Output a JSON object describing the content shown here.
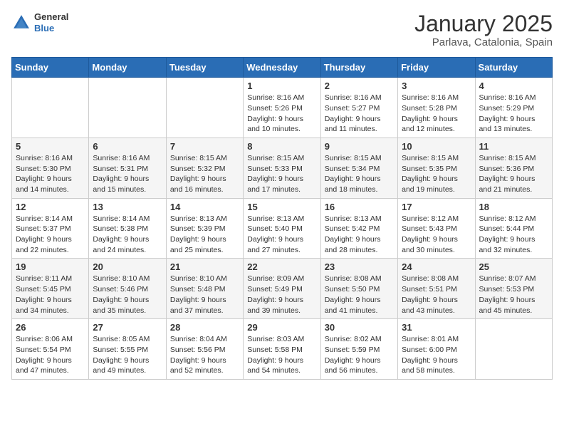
{
  "header": {
    "logo_general": "General",
    "logo_blue": "Blue",
    "title": "January 2025",
    "subtitle": "Parlava, Catalonia, Spain"
  },
  "days_of_week": [
    "Sunday",
    "Monday",
    "Tuesday",
    "Wednesday",
    "Thursday",
    "Friday",
    "Saturday"
  ],
  "weeks": [
    [
      {
        "day": "",
        "sunrise": "",
        "sunset": "",
        "daylight": ""
      },
      {
        "day": "",
        "sunrise": "",
        "sunset": "",
        "daylight": ""
      },
      {
        "day": "",
        "sunrise": "",
        "sunset": "",
        "daylight": ""
      },
      {
        "day": "1",
        "sunrise": "Sunrise: 8:16 AM",
        "sunset": "Sunset: 5:26 PM",
        "daylight": "Daylight: 9 hours and 10 minutes."
      },
      {
        "day": "2",
        "sunrise": "Sunrise: 8:16 AM",
        "sunset": "Sunset: 5:27 PM",
        "daylight": "Daylight: 9 hours and 11 minutes."
      },
      {
        "day": "3",
        "sunrise": "Sunrise: 8:16 AM",
        "sunset": "Sunset: 5:28 PM",
        "daylight": "Daylight: 9 hours and 12 minutes."
      },
      {
        "day": "4",
        "sunrise": "Sunrise: 8:16 AM",
        "sunset": "Sunset: 5:29 PM",
        "daylight": "Daylight: 9 hours and 13 minutes."
      }
    ],
    [
      {
        "day": "5",
        "sunrise": "Sunrise: 8:16 AM",
        "sunset": "Sunset: 5:30 PM",
        "daylight": "Daylight: 9 hours and 14 minutes."
      },
      {
        "day": "6",
        "sunrise": "Sunrise: 8:16 AM",
        "sunset": "Sunset: 5:31 PM",
        "daylight": "Daylight: 9 hours and 15 minutes."
      },
      {
        "day": "7",
        "sunrise": "Sunrise: 8:15 AM",
        "sunset": "Sunset: 5:32 PM",
        "daylight": "Daylight: 9 hours and 16 minutes."
      },
      {
        "day": "8",
        "sunrise": "Sunrise: 8:15 AM",
        "sunset": "Sunset: 5:33 PM",
        "daylight": "Daylight: 9 hours and 17 minutes."
      },
      {
        "day": "9",
        "sunrise": "Sunrise: 8:15 AM",
        "sunset": "Sunset: 5:34 PM",
        "daylight": "Daylight: 9 hours and 18 minutes."
      },
      {
        "day": "10",
        "sunrise": "Sunrise: 8:15 AM",
        "sunset": "Sunset: 5:35 PM",
        "daylight": "Daylight: 9 hours and 19 minutes."
      },
      {
        "day": "11",
        "sunrise": "Sunrise: 8:15 AM",
        "sunset": "Sunset: 5:36 PM",
        "daylight": "Daylight: 9 hours and 21 minutes."
      }
    ],
    [
      {
        "day": "12",
        "sunrise": "Sunrise: 8:14 AM",
        "sunset": "Sunset: 5:37 PM",
        "daylight": "Daylight: 9 hours and 22 minutes."
      },
      {
        "day": "13",
        "sunrise": "Sunrise: 8:14 AM",
        "sunset": "Sunset: 5:38 PM",
        "daylight": "Daylight: 9 hours and 24 minutes."
      },
      {
        "day": "14",
        "sunrise": "Sunrise: 8:13 AM",
        "sunset": "Sunset: 5:39 PM",
        "daylight": "Daylight: 9 hours and 25 minutes."
      },
      {
        "day": "15",
        "sunrise": "Sunrise: 8:13 AM",
        "sunset": "Sunset: 5:40 PM",
        "daylight": "Daylight: 9 hours and 27 minutes."
      },
      {
        "day": "16",
        "sunrise": "Sunrise: 8:13 AM",
        "sunset": "Sunset: 5:42 PM",
        "daylight": "Daylight: 9 hours and 28 minutes."
      },
      {
        "day": "17",
        "sunrise": "Sunrise: 8:12 AM",
        "sunset": "Sunset: 5:43 PM",
        "daylight": "Daylight: 9 hours and 30 minutes."
      },
      {
        "day": "18",
        "sunrise": "Sunrise: 8:12 AM",
        "sunset": "Sunset: 5:44 PM",
        "daylight": "Daylight: 9 hours and 32 minutes."
      }
    ],
    [
      {
        "day": "19",
        "sunrise": "Sunrise: 8:11 AM",
        "sunset": "Sunset: 5:45 PM",
        "daylight": "Daylight: 9 hours and 34 minutes."
      },
      {
        "day": "20",
        "sunrise": "Sunrise: 8:10 AM",
        "sunset": "Sunset: 5:46 PM",
        "daylight": "Daylight: 9 hours and 35 minutes."
      },
      {
        "day": "21",
        "sunrise": "Sunrise: 8:10 AM",
        "sunset": "Sunset: 5:48 PM",
        "daylight": "Daylight: 9 hours and 37 minutes."
      },
      {
        "day": "22",
        "sunrise": "Sunrise: 8:09 AM",
        "sunset": "Sunset: 5:49 PM",
        "daylight": "Daylight: 9 hours and 39 minutes."
      },
      {
        "day": "23",
        "sunrise": "Sunrise: 8:08 AM",
        "sunset": "Sunset: 5:50 PM",
        "daylight": "Daylight: 9 hours and 41 minutes."
      },
      {
        "day": "24",
        "sunrise": "Sunrise: 8:08 AM",
        "sunset": "Sunset: 5:51 PM",
        "daylight": "Daylight: 9 hours and 43 minutes."
      },
      {
        "day": "25",
        "sunrise": "Sunrise: 8:07 AM",
        "sunset": "Sunset: 5:53 PM",
        "daylight": "Daylight: 9 hours and 45 minutes."
      }
    ],
    [
      {
        "day": "26",
        "sunrise": "Sunrise: 8:06 AM",
        "sunset": "Sunset: 5:54 PM",
        "daylight": "Daylight: 9 hours and 47 minutes."
      },
      {
        "day": "27",
        "sunrise": "Sunrise: 8:05 AM",
        "sunset": "Sunset: 5:55 PM",
        "daylight": "Daylight: 9 hours and 49 minutes."
      },
      {
        "day": "28",
        "sunrise": "Sunrise: 8:04 AM",
        "sunset": "Sunset: 5:56 PM",
        "daylight": "Daylight: 9 hours and 52 minutes."
      },
      {
        "day": "29",
        "sunrise": "Sunrise: 8:03 AM",
        "sunset": "Sunset: 5:58 PM",
        "daylight": "Daylight: 9 hours and 54 minutes."
      },
      {
        "day": "30",
        "sunrise": "Sunrise: 8:02 AM",
        "sunset": "Sunset: 5:59 PM",
        "daylight": "Daylight: 9 hours and 56 minutes."
      },
      {
        "day": "31",
        "sunrise": "Sunrise: 8:01 AM",
        "sunset": "Sunset: 6:00 PM",
        "daylight": "Daylight: 9 hours and 58 minutes."
      },
      {
        "day": "",
        "sunrise": "",
        "sunset": "",
        "daylight": ""
      }
    ]
  ]
}
